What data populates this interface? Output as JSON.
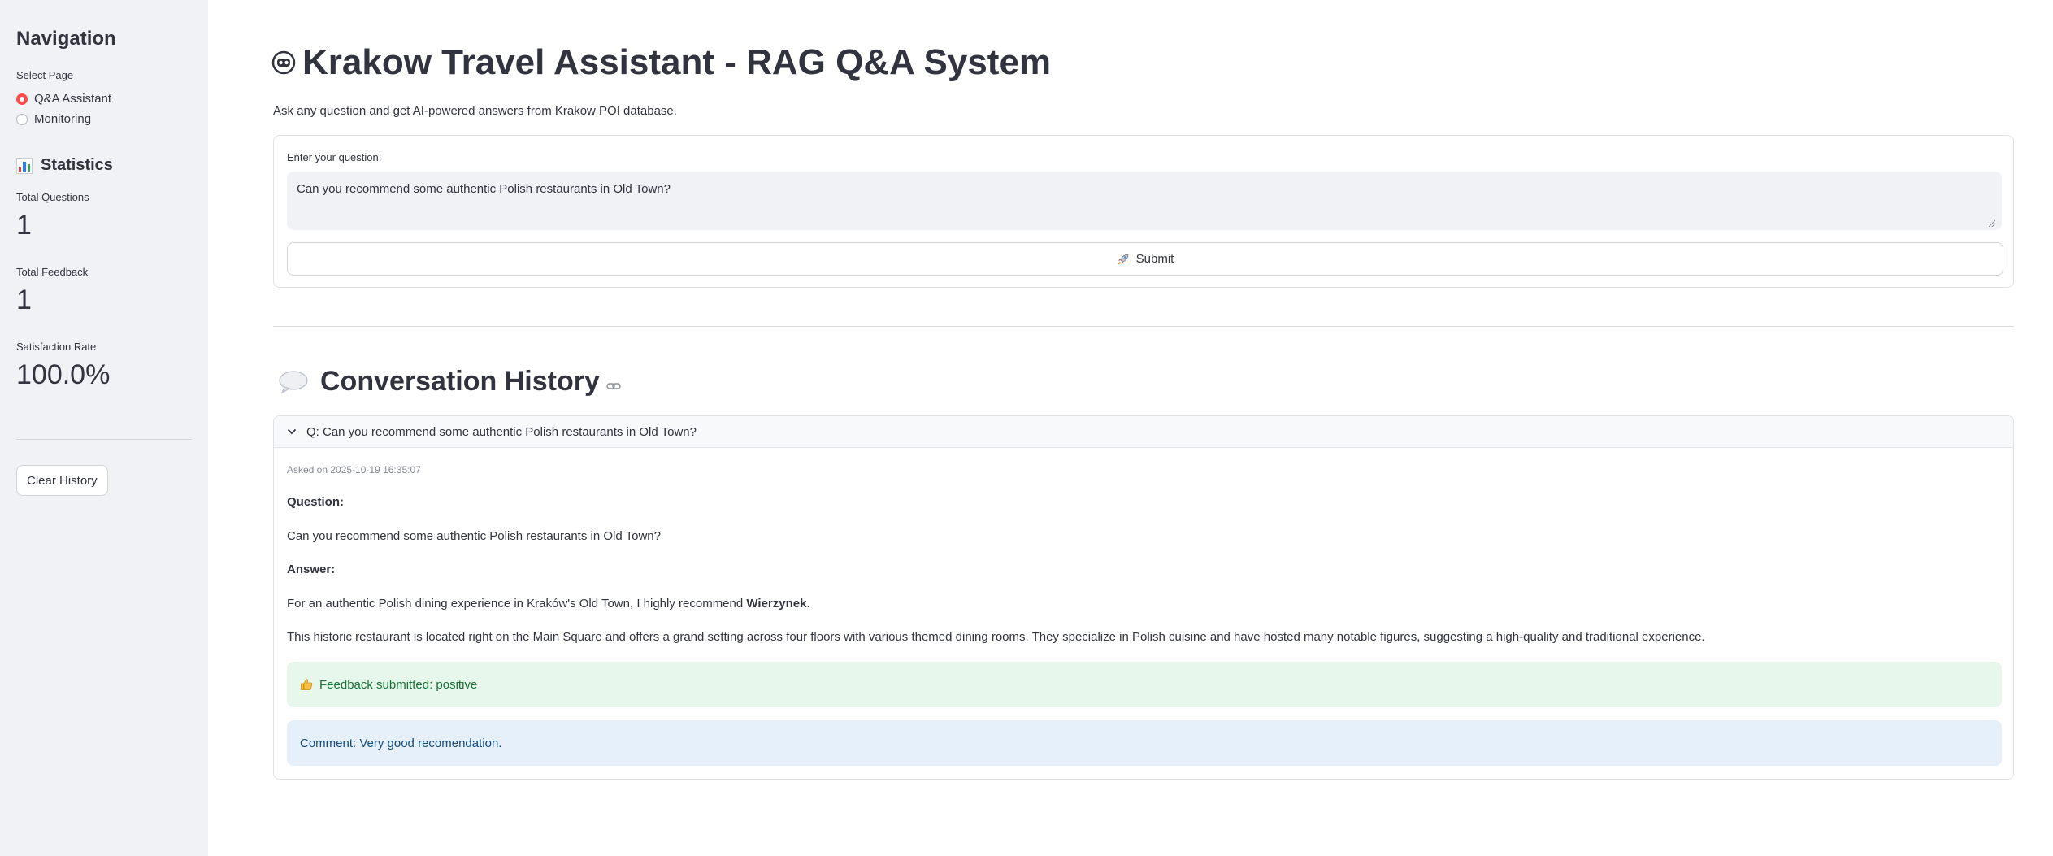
{
  "sidebar": {
    "title": "Navigation",
    "select_page_label": "Select Page",
    "pages": [
      {
        "label": "Q&A Assistant",
        "selected": true
      },
      {
        "label": "Monitoring",
        "selected": false
      }
    ],
    "stats_title": "Statistics",
    "metrics": [
      {
        "label": "Total Questions",
        "value": "1"
      },
      {
        "label": "Total Feedback",
        "value": "1"
      },
      {
        "label": "Satisfaction Rate",
        "value": "100.0%"
      }
    ],
    "clear_button": "Clear History"
  },
  "main": {
    "title": "Krakow Travel Assistant - RAG Q&A System",
    "subtitle": "Ask any question and get AI-powered answers from Krakow POI database.",
    "question_label": "Enter your question:",
    "question_value": "Can you recommend some authentic Polish restaurants in Old Town?",
    "submit_label": "Submit",
    "conversation_title": "Conversation History",
    "entry": {
      "header": "Q: Can you recommend some authentic Polish restaurants in Old Town?",
      "asked_on": "Asked on 2025-10-19 16:35:07",
      "question_heading": "Question:",
      "question_text": "Can you recommend some authentic Polish restaurants in Old Town?",
      "answer_heading": "Answer:",
      "answer_p1_before": "For an authentic Polish dining experience in Kraków's Old Town, I highly recommend ",
      "answer_p1_bold": "Wierzynek",
      "answer_p1_after": ".",
      "answer_p2": "This historic restaurant is located right on the Main Square and offers a grand setting across four floors with various themed dining rooms. They specialize in Polish cuisine and have hosted many notable figures, suggesting a high-quality and traditional experience.",
      "feedback": "Feedback submitted: positive",
      "comment": "Comment: Very good recomendation."
    }
  },
  "colors": {
    "accent": "#ff4b4b",
    "sidebar_bg": "#f0f2f6",
    "success_bg": "#e8f7ec",
    "success_text": "#177233",
    "info_bg": "#e6f0fb",
    "info_text": "#104b7d"
  },
  "icons": {
    "title": "robot-icon",
    "stats": "bar-chart-icon",
    "submit": "rocket-icon",
    "conversation": "speech-bubble-icon",
    "anchor": "link-icon",
    "expander": "chevron-down-icon",
    "feedback": "thumbs-up-icon"
  }
}
